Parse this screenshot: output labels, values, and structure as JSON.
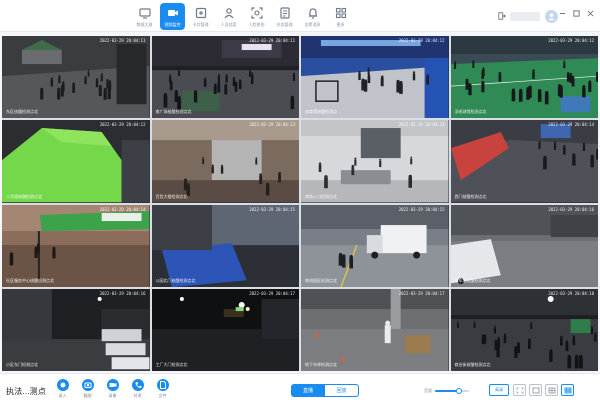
{
  "nav": {
    "items": [
      {
        "label": "数据大屏",
        "icon": "dashboard-icon"
      },
      {
        "label": "视频监控",
        "icon": "camera-icon",
        "active": true
      },
      {
        "label": "卡口管理",
        "icon": "checkpoint-icon"
      },
      {
        "label": "人员档案",
        "icon": "person-icon"
      },
      {
        "label": "人脸抓拍",
        "icon": "face-icon"
      },
      {
        "label": "任务管理",
        "icon": "task-icon"
      },
      {
        "label": "告警消息",
        "icon": "bell-icon"
      },
      {
        "label": "更多",
        "icon": "more-icon"
      }
    ]
  },
  "tiles": [
    {
      "name": "东区核酸检测点北",
      "ts": "2022-03-29 20:04:11",
      "scene": "night-street"
    },
    {
      "name": "南广场核酸检测点北",
      "ts": "2022-03-29 20:04:11",
      "scene": "night-plaza"
    },
    {
      "name": "体育馆核酸检测点",
      "ts": "2022-03-29 20:04:12",
      "scene": "gym"
    },
    {
      "name": "羽毛球馆检测点北",
      "ts": "2022-03-29 20:04:12",
      "scene": "green-court"
    },
    {
      "name": "二号楼核酸检测点北",
      "ts": "2022-03-29 20:04:12",
      "scene": "green-tent"
    },
    {
      "name": "百货大楼检测点北",
      "ts": "2022-03-29 20:04:13",
      "scene": "indoor-queue"
    },
    {
      "name": "商场入口检测点北",
      "ts": "2022-03-29 20:04:13",
      "scene": "indoor-office"
    },
    {
      "name": "西门核酸检测点北",
      "ts": "2022-03-29 20:04:14",
      "scene": "barrier-street"
    },
    {
      "name": "社区服务中心核酸检测点北",
      "ts": "2022-03-29 20:04:14",
      "scene": "tent-green"
    },
    {
      "name": "公园北门核酸检测点北",
      "ts": "2022-03-29 20:04:15",
      "scene": "blue-tarp"
    },
    {
      "name": "物流园区检测点北",
      "ts": "2022-03-29 20:04:15",
      "scene": "truck"
    },
    {
      "name": "停车场核酸检测点北",
      "ts": "2022-03-29 20:04:16",
      "scene": "van-lot"
    },
    {
      "name": "小区东门检测点北",
      "ts": "2022-03-29 20:04:16",
      "scene": "night-parking"
    },
    {
      "name": "工厂大门检测点北",
      "ts": "2022-03-29 20:04:17",
      "scene": "night-lights"
    },
    {
      "name": "地下车库检测点北",
      "ts": "2022-03-29 20:04:17",
      "scene": "garage-worker"
    },
    {
      "name": "商业街核酸检测点北",
      "ts": "2022-03-29 20:04:18",
      "scene": "night-crowd"
    }
  ],
  "bottom": {
    "place_title": "执法...测点",
    "tools": [
      {
        "label": "录入",
        "icon": "record-icon"
      },
      {
        "label": "截图",
        "icon": "screenshot-icon"
      },
      {
        "label": "录像",
        "icon": "video-icon"
      },
      {
        "label": "对讲",
        "icon": "phone-icon"
      },
      {
        "label": "文件",
        "icon": "file-icon"
      }
    ],
    "mode_live": "直播",
    "mode_playback": "回放",
    "volume_caption": "音量",
    "volume_level": 0.72,
    "quality": "高清"
  },
  "colors": {
    "accent": "#1a8cf0"
  }
}
